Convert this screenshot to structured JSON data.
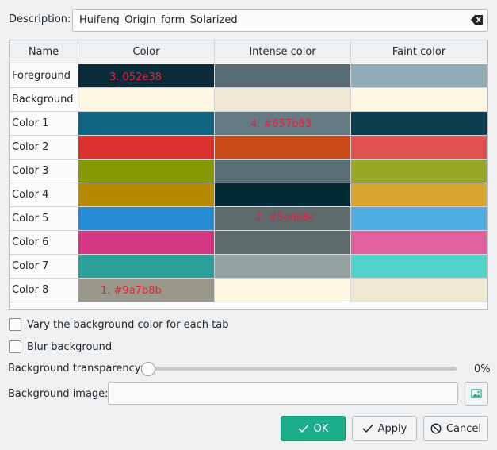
{
  "description": {
    "label": "Description:",
    "value": "Huifeng_Origin_form_Solarized",
    "clear_icon": "backspace-clear-icon"
  },
  "table": {
    "headers": [
      "Name",
      "Color",
      "Intense color",
      "Faint color"
    ],
    "rows": [
      {
        "name": "Foreground",
        "color": "#0a2b38",
        "intense": "#5a6b74",
        "faint": "#8fabb5"
      },
      {
        "name": "Background",
        "color": "#fdf6e3",
        "intense": "#eee8d5",
        "faint": "#fdf6e3"
      },
      {
        "name": "Color 1",
        "color": "#0e6683",
        "intense": "#657b83",
        "faint": "#0a3d4c"
      },
      {
        "name": "Color 2",
        "color": "#dc322f",
        "intense": "#cb4b16",
        "faint": "#e05252"
      },
      {
        "name": "Color 3",
        "color": "#859900",
        "intense": "#586e75",
        "faint": "#98a826"
      },
      {
        "name": "Color 4",
        "color": "#b58900",
        "intense": "#002b36",
        "faint": "#d8a62e"
      },
      {
        "name": "Color 5",
        "color": "#268bd2",
        "intense": "#5e6b6c",
        "faint": "#4fade3"
      },
      {
        "name": "Color 6",
        "color": "#d33682",
        "intense": "#5e6b6c",
        "faint": "#e160a0"
      },
      {
        "name": "Color 7",
        "color": "#2aa198",
        "intense": "#93a1a1",
        "faint": "#4fd3c8"
      },
      {
        "name": "Color 8",
        "color": "#9a978b",
        "intense": "#fdf6e3",
        "faint": "#eee8d5"
      }
    ]
  },
  "annotations": {
    "a3": "3. 052e38",
    "a4": "4. #657b83",
    "a2": "2. #5e6b6c",
    "a1": "1. #9a7b8b"
  },
  "options": {
    "vary_bg": "Vary the background color for each tab",
    "blur_bg": "Blur background",
    "transparency_label": "Background transparency:",
    "transparency_value": "0%",
    "transparency_fraction": 0,
    "image_label": "Background image:",
    "image_value": "",
    "image_button_icon": "image-picker-icon"
  },
  "buttons": {
    "ok": "OK",
    "apply": "Apply",
    "cancel": "Cancel"
  },
  "colors": {
    "accent": "#1aaf8a",
    "annotation": "#ed1c3c"
  }
}
